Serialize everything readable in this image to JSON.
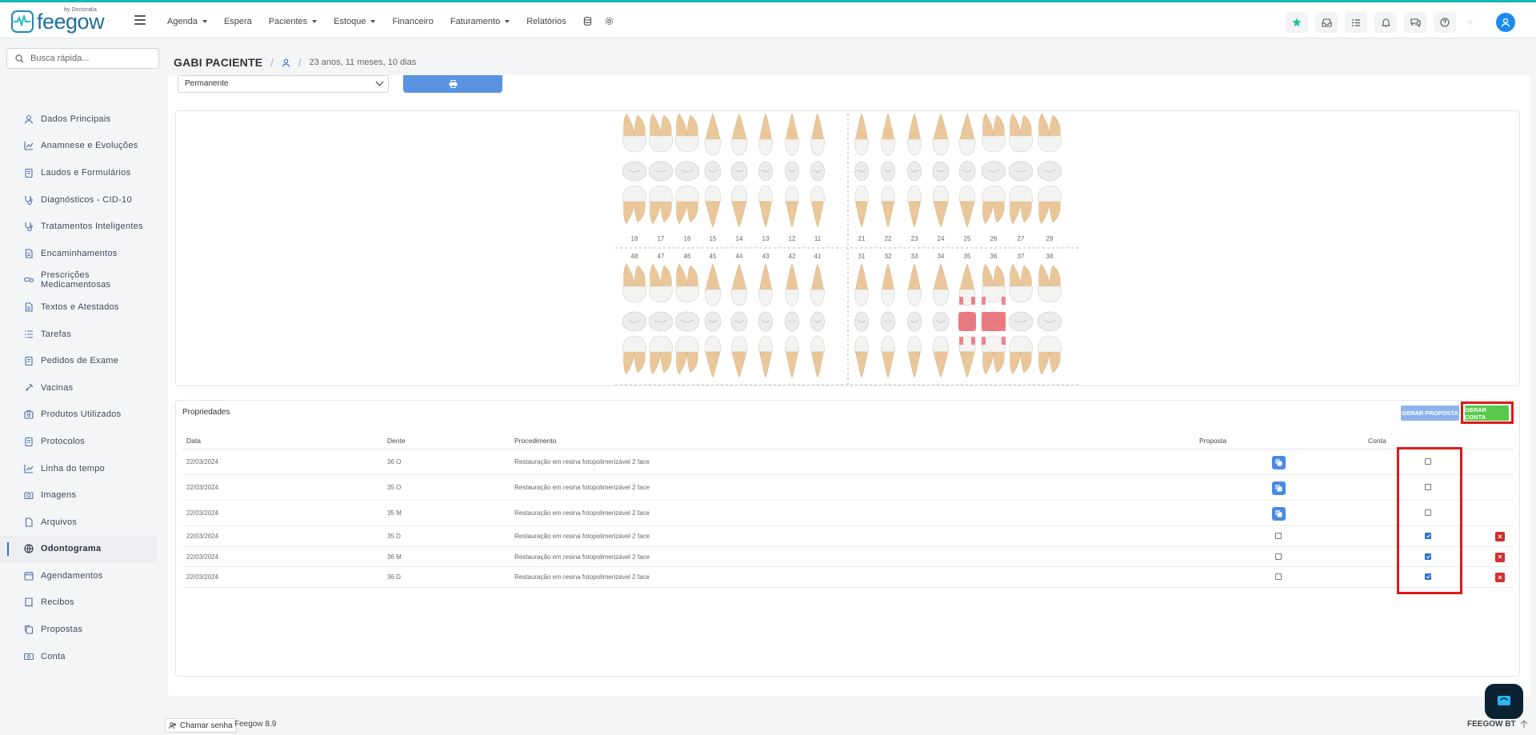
{
  "brand": {
    "name": "feegow",
    "sub": "by Doctoralia"
  },
  "menu": [
    {
      "label": "Agenda",
      "caret": true
    },
    {
      "label": "Espera",
      "caret": false
    },
    {
      "label": "Pacientes",
      "caret": true
    },
    {
      "label": "Estoque",
      "caret": true
    },
    {
      "label": "Financeiro",
      "caret": false
    },
    {
      "label": "Faturamento",
      "caret": true
    },
    {
      "label": "Relatórios",
      "caret": false
    }
  ],
  "search": {
    "placeholder": "Busca rápida..."
  },
  "sidebar": {
    "items": [
      {
        "label": "Dados Principais",
        "icon": "user-icon"
      },
      {
        "label": "Anamnese e Evoluções",
        "icon": "chart-icon"
      },
      {
        "label": "Laudos e Formulários",
        "icon": "clipboard-icon"
      },
      {
        "label": "Diagnósticos - CID-10",
        "icon": "stethoscope-icon"
      },
      {
        "label": "Tratamentos Inteligentes",
        "icon": "stethoscope-icon"
      },
      {
        "label": "Encaminhamentos",
        "icon": "document-icon"
      },
      {
        "label": "Prescrições Medicamentosas",
        "icon": "pills-icon"
      },
      {
        "label": "Textos e Atestados",
        "icon": "document-icon"
      },
      {
        "label": "Tarefas",
        "icon": "list-icon"
      },
      {
        "label": "Pedidos de Exame",
        "icon": "clipboard-icon"
      },
      {
        "label": "Vacinas",
        "icon": "syringe-icon"
      },
      {
        "label": "Produtos Utilizados",
        "icon": "box-icon"
      },
      {
        "label": "Protocolos",
        "icon": "clipboard-icon"
      },
      {
        "label": "Linha do tempo",
        "icon": "chart-icon"
      },
      {
        "label": "Imagens",
        "icon": "camera-icon"
      },
      {
        "label": "Arquivos",
        "icon": "file-icon"
      },
      {
        "label": "Odontograma",
        "icon": "globe-icon",
        "active": true
      },
      {
        "label": "Agendamentos",
        "icon": "calendar-icon"
      },
      {
        "label": "Recibos",
        "icon": "receipt-icon"
      },
      {
        "label": "Propostas",
        "icon": "copy-icon"
      },
      {
        "label": "Conta",
        "icon": "money-icon"
      }
    ]
  },
  "patient": {
    "name": "GABI PACIENTE",
    "age": "23 anos, 11 meses, 10 dias"
  },
  "dentition_select": {
    "value": "Permanente"
  },
  "odontogram": {
    "upper_numbers": [
      "18",
      "17",
      "16",
      "15",
      "14",
      "13",
      "12",
      "11",
      "21",
      "22",
      "23",
      "24",
      "25",
      "26",
      "27",
      "28"
    ],
    "lower_numbers": [
      "48",
      "47",
      "46",
      "45",
      "44",
      "43",
      "42",
      "41",
      "31",
      "32",
      "33",
      "34",
      "35",
      "36",
      "37",
      "38"
    ],
    "marked_teeth": [
      "35",
      "36"
    ],
    "mark_color": "#e8545e"
  },
  "properties": {
    "title": "Propriedades",
    "btn_proposta": "GERAR PROPOSTA",
    "btn_conta": "GERAR CONTA",
    "headers": {
      "data": "Data",
      "dente": "Dente",
      "procedimento": "Procedimento",
      "proposta": "Proposta",
      "conta": "Conta"
    },
    "rows": [
      {
        "data": "22/03/2024",
        "dente": "36 O",
        "procedimento": "Restauração em resina fotopolimerizável 2 face",
        "proposta": "button",
        "conta": false,
        "delete": false
      },
      {
        "data": "22/03/2024",
        "dente": "35 O",
        "procedimento": "Restauração em resina fotopolimerizável 2 face",
        "proposta": "button",
        "conta": false,
        "delete": false
      },
      {
        "data": "22/03/2024",
        "dente": "35 M",
        "procedimento": "Restauração em resina fotopolimerizável 2 face",
        "proposta": "button",
        "conta": false,
        "delete": false
      },
      {
        "data": "22/03/2024",
        "dente": "35 D",
        "procedimento": "Restauração em resina fotopolimerizável 2 face",
        "proposta": "checkbox",
        "conta": true,
        "delete": true
      },
      {
        "data": "22/03/2024",
        "dente": "36 M",
        "procedimento": "Restauração em resina fotopolimerizável 2 face",
        "proposta": "checkbox",
        "conta": true,
        "delete": true
      },
      {
        "data": "22/03/2024",
        "dente": "36 D",
        "procedimento": "Restauração em resina fotopolimerizável 2 face",
        "proposta": "checkbox",
        "conta": true,
        "delete": true
      }
    ]
  },
  "footer": {
    "chamar": "Chamar senha",
    "version": "Feegow 8.9",
    "right": "FEEGOW BT"
  },
  "colors": {
    "accent": "#14b8b5",
    "primary": "#4c8ae2",
    "success": "#58c94a",
    "danger": "#d32f2f",
    "highlight": "#e01818"
  }
}
